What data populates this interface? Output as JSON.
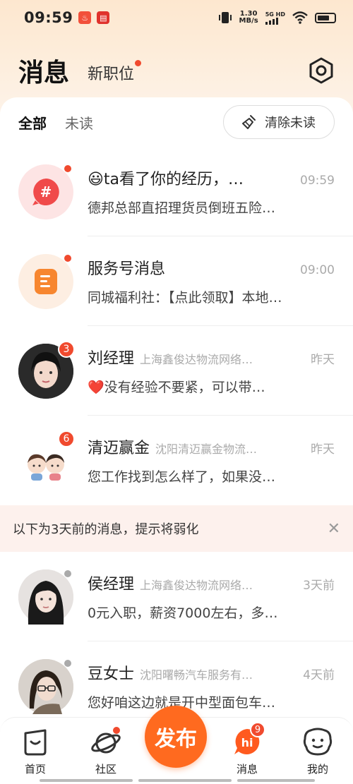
{
  "status_bar": {
    "time": "09:59",
    "net_speed_value": "1.30",
    "net_speed_unit": "MB/s",
    "network_label": "5G HD"
  },
  "header": {
    "title": "消息",
    "new_jobs_tab": "新职位"
  },
  "filters": {
    "all": "全部",
    "unread": "未读",
    "clear_unread": "清除未读"
  },
  "messages": [
    {
      "name": "😃ta看了你的经历，…",
      "company": "",
      "time": "09:59",
      "preview": "德邦总部直招理货员倒班五险…",
      "badge": "",
      "icon": "hashtag-icon"
    },
    {
      "name": "服务号消息",
      "company": "",
      "time": "09:00",
      "preview": "同城福利社：【点此领取】本地…",
      "badge": "",
      "icon": "document-icon"
    },
    {
      "name": "刘经理",
      "company": "上海鑫俊达物流网络…",
      "time": "昨天",
      "preview": "❤️没有经验不要紧，可以带…",
      "badge": "3",
      "icon": "avatar-photo"
    },
    {
      "name": "清迈赢金",
      "company": "沈阳清迈赢金物流…",
      "time": "昨天",
      "preview": "您工作找到怎么样了，如果没…",
      "badge": "6",
      "icon": "avatar-cartoon"
    }
  ],
  "notice": {
    "text": "以下为3天前的消息，提示将弱化"
  },
  "old_messages": [
    {
      "name": "侯经理",
      "company": "上海鑫俊达物流网络…",
      "time": "3天前",
      "preview": "0元入职，薪资7000左右，多…"
    },
    {
      "name": "豆女士",
      "company": "沈阳曙畅汽车服务有…",
      "time": "4天前",
      "preview": "您好咱这边就是开中型面包车…"
    }
  ],
  "bottom_nav": {
    "home": "首页",
    "community": "社区",
    "publish": "发布",
    "messages": "消息",
    "messages_badge": "9",
    "hi_icon_text": "hi",
    "mine": "我的"
  },
  "colors": {
    "accent": "#ff6a1f",
    "badge_red": "#f04a2e"
  }
}
